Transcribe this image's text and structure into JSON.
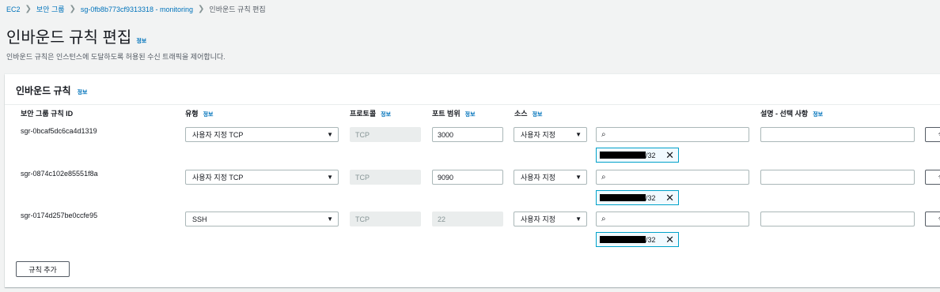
{
  "breadcrumb": [
    {
      "label": "EC2",
      "link": true
    },
    {
      "label": "보안 그룹",
      "link": true
    },
    {
      "label": "sg-0fb8b773cf9313318 - monitoring",
      "link": true
    },
    {
      "label": "인바운드 규칙 편집",
      "link": false
    }
  ],
  "page": {
    "title": "인바운드 규칙 편집",
    "info": "정보",
    "description": "인바운드 규칙은 인스턴스에 도달하도록 허용된 수신 트래픽을 제어합니다."
  },
  "panel": {
    "title": "인바운드 규칙",
    "info": "정보",
    "columns": {
      "rule_id": "보안 그룹 규칙 ID",
      "type": "유형",
      "protocol": "프로토콜",
      "port_range": "포트 범위",
      "source": "소스",
      "description": "설명 - 선택 사항",
      "info": "정보"
    },
    "rules": [
      {
        "id": "sgr-0bcaf5dc6ca4d1319",
        "type": "사용자 지정 TCP",
        "protocol": "TCP",
        "port": "3000",
        "port_disabled": false,
        "source": "사용자 지정",
        "search": "",
        "cidr_suffix": "/32",
        "description": "",
        "delete_label": "삭"
      },
      {
        "id": "sgr-0874c102e85551f8a",
        "type": "사용자 지정 TCP",
        "protocol": "TCP",
        "port": "9090",
        "port_disabled": false,
        "source": "사용자 지정",
        "search": "",
        "cidr_suffix": "/32",
        "description": "",
        "delete_label": "삭"
      },
      {
        "id": "sgr-0174d257be0ccfe95",
        "type": "SSH",
        "protocol": "TCP",
        "port": "22",
        "port_disabled": true,
        "source": "사용자 지정",
        "search": "",
        "cidr_suffix": "/32",
        "description": "",
        "delete_label": "삭"
      }
    ],
    "add_rule_label": "규칙 추가"
  },
  "icons": {
    "separator": "chevron-right-icon",
    "dropdown": "caret-down-icon",
    "search": "search-icon",
    "remove": "close-icon"
  },
  "colors": {
    "link": "#0073bb",
    "background": "#f2f3f3",
    "token_border": "#00a1c9"
  }
}
